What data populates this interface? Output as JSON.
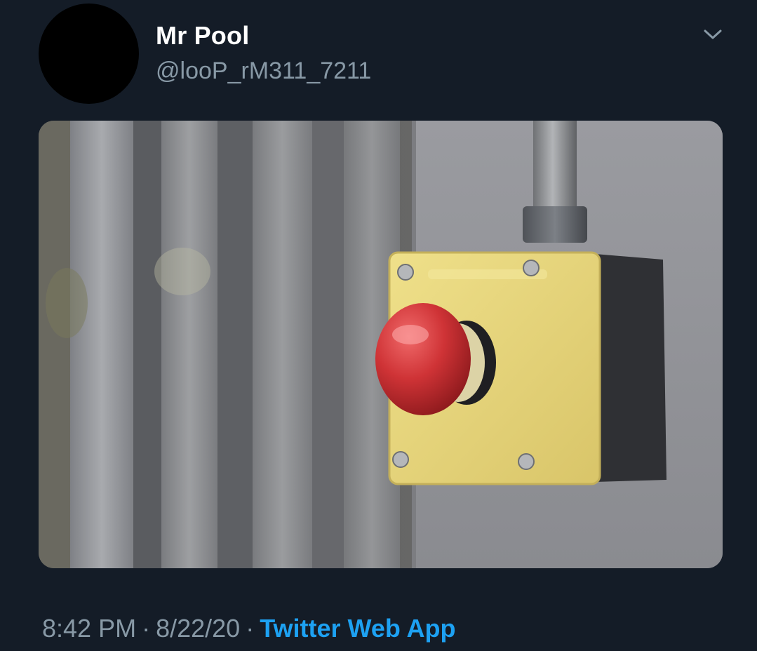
{
  "tweet": {
    "display_name": "Mr Pool",
    "handle": "@looP_rM311_7211",
    "time": "8:42 PM",
    "date": "8/22/20",
    "separator": "·",
    "source": "Twitter Web App",
    "menu_icon": "chevron-down-icon"
  },
  "colors": {
    "background": "#141c27",
    "link": "#1da1f2",
    "secondary_text": "#8899a6"
  }
}
